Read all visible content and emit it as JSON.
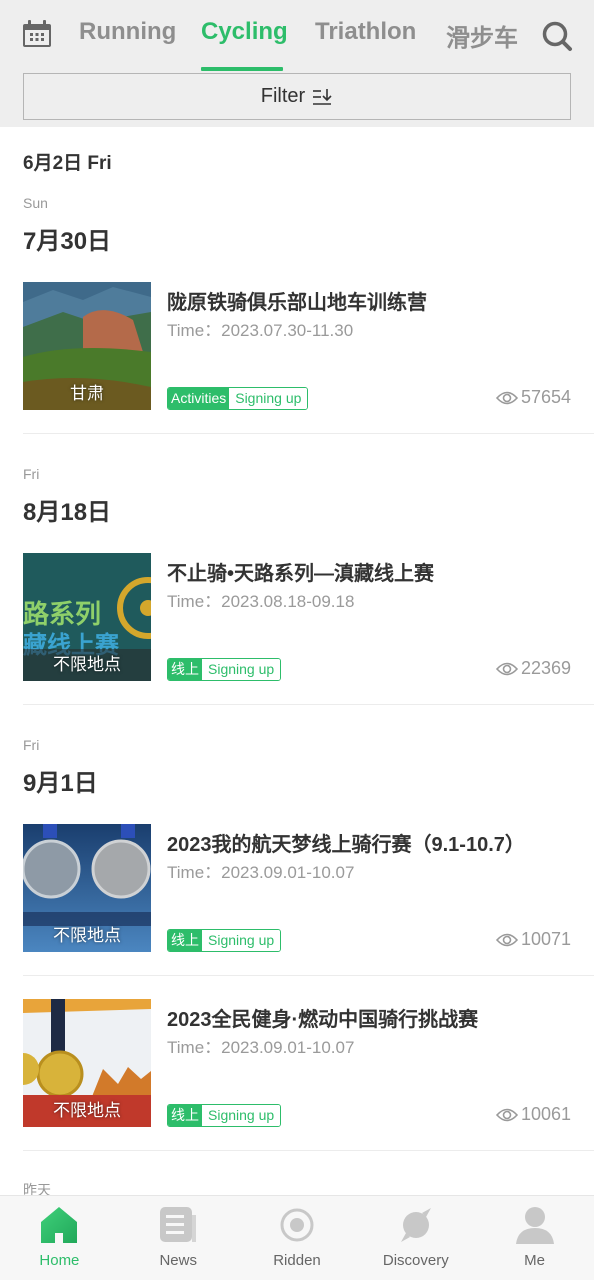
{
  "header": {
    "calendar_icon": "calendar-icon",
    "tabs": [
      {
        "label": "Running",
        "active": false
      },
      {
        "label": "Cycling",
        "active": true
      },
      {
        "label": "Triathlon",
        "active": false
      },
      {
        "label": "滑步车",
        "active": false
      }
    ],
    "search_icon": "search-icon",
    "filter_label": "Filter",
    "filter_icon": "sort-filter-icon"
  },
  "accent_color": "#2dbd6a",
  "today_label": "6月2日 Fri",
  "sections": [
    {
      "weekday": "Sun",
      "date": "7月30日",
      "events": [
        {
          "title": "陇原铁骑俱乐部山地车训练营",
          "time": "Time：2023.07.30-11.30",
          "location": "甘肃",
          "type_tag": "Activities",
          "status_tag": "Signing up",
          "views": "57654"
        }
      ]
    },
    {
      "weekday": "Fri",
      "date": "8月18日",
      "events": [
        {
          "title": "不止骑•天路系列—滇藏线上赛",
          "time": "Time：2023.08.18-09.18",
          "location": "不限地点",
          "type_tag": "线上",
          "status_tag": "Signing up",
          "views": "22369"
        }
      ]
    },
    {
      "weekday": "Fri",
      "date": "9月1日",
      "events": [
        {
          "title": "2023我的航天梦线上骑行赛（9.1-10.7）",
          "time": "Time：2023.09.01-10.07",
          "location": "不限地点",
          "type_tag": "线上",
          "status_tag": "Signing up",
          "views": "10071"
        },
        {
          "title": "2023全民健身·燃动中国骑行挑战赛",
          "time": "Time：2023.09.01-10.07",
          "location": "不限地点",
          "type_tag": "线上",
          "status_tag": "Signing up",
          "views": "10061"
        }
      ]
    }
  ],
  "yesterday_label": "昨天",
  "bottom_nav": [
    {
      "label": "Home",
      "icon": "home-icon",
      "active": true
    },
    {
      "label": "News",
      "icon": "news-icon",
      "active": false
    },
    {
      "label": "Ridden",
      "icon": "ridden-icon",
      "active": false
    },
    {
      "label": "Discovery",
      "icon": "discovery-icon",
      "active": false
    },
    {
      "label": "Me",
      "icon": "profile-icon",
      "active": false
    }
  ]
}
